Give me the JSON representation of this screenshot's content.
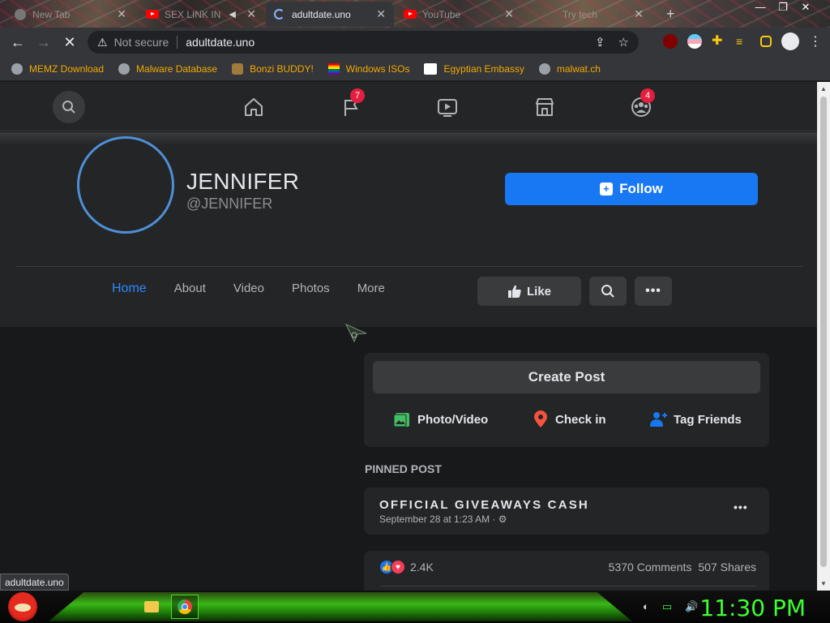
{
  "browser": {
    "tabs": [
      {
        "title": "New Tab",
        "icon": "chrome-icon",
        "active": false
      },
      {
        "title": "SEX LINK IN",
        "icon": "youtube-icon",
        "active": false,
        "muted": true
      },
      {
        "title": "adultdate.uno",
        "icon": "loading-spinner",
        "active": true
      },
      {
        "title": "YouTube",
        "icon": "youtube-icon",
        "active": false
      },
      {
        "title": "Try tech",
        "icon": "generic-icon",
        "active": false
      }
    ],
    "security_label": "Not secure",
    "url": "adultdate.uno",
    "bookmarks": [
      {
        "label": "MEMZ Download",
        "icon": "globe-icon"
      },
      {
        "label": "Malware Database",
        "icon": "globe-icon"
      },
      {
        "label": "Bonzi BUDDY!",
        "icon": "bonzi-icon"
      },
      {
        "label": "Windows ISOs",
        "icon": "pride-flag-icon"
      },
      {
        "label": "Egyptian Embassy",
        "icon": "wix-icon"
      },
      {
        "label": "malwat.ch",
        "icon": "globe-icon"
      }
    ],
    "status_url": "adultdate.uno"
  },
  "nav": {
    "notifications_count": "7",
    "groups_count": "4"
  },
  "profile": {
    "name": "JENNIFER",
    "handle": "@JENNIFER",
    "follow_label": "Follow",
    "tabs": [
      "Home",
      "About",
      "Video",
      "Photos",
      "More"
    ],
    "like_label": "Like"
  },
  "composer": {
    "create_label": "Create Post",
    "photo_label": "Photo/Video",
    "checkin_label": "Check in",
    "tag_label": "Tag Friends"
  },
  "pinned": {
    "section_label": "PINNED POST",
    "title": "OFFICIAL GIVEAWAYS CASH",
    "date": "September 28 at 1:23 AM · ",
    "reactions": "2.4K",
    "comments": "5370 Comments",
    "shares": "507 Shares"
  },
  "taskbar": {
    "clock": "11:30 PM"
  },
  "colors": {
    "accent": "#1877f2",
    "page_bg": "#18191a",
    "card_bg": "#242526",
    "clock_green": "#3cff32"
  }
}
